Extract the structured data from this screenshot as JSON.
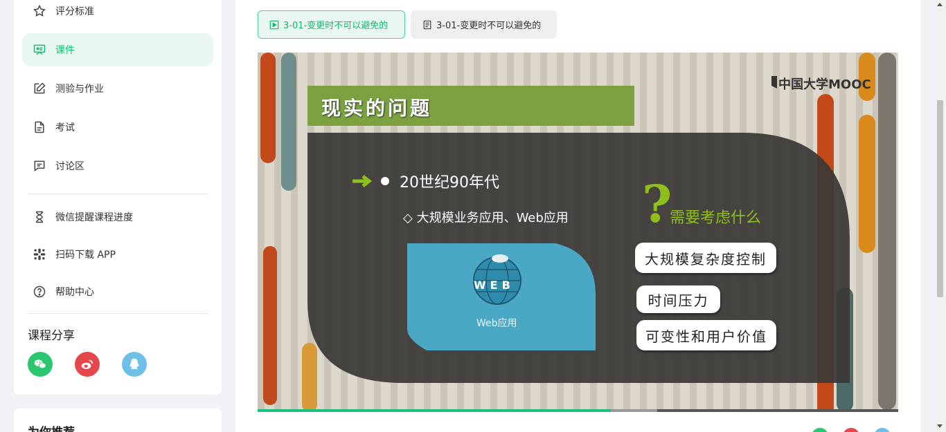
{
  "sidebar": {
    "items": [
      {
        "label": "评分标准",
        "icon": "star-icon"
      },
      {
        "label": "课件",
        "icon": "courseware-icon"
      },
      {
        "label": "测验与作业",
        "icon": "edit-icon"
      },
      {
        "label": "考试",
        "icon": "document-icon"
      },
      {
        "label": "讨论区",
        "icon": "chat-icon"
      }
    ],
    "extra_items": [
      {
        "label": "微信提醒课程进度",
        "icon": "hourglass-icon"
      },
      {
        "label": "扫码下载 APP",
        "icon": "qr-icon"
      },
      {
        "label": "帮助中心",
        "icon": "help-icon"
      }
    ],
    "share_title": "课程分享",
    "recommend_title": "为你推荐"
  },
  "tabs": [
    {
      "label": "3-01-变更时不可以避免的",
      "icon": "video-icon",
      "active": true
    },
    {
      "label": "3-01-变更时不可以避免的",
      "icon": "document-icon",
      "active": false
    }
  ],
  "slide": {
    "title": "现实的问题",
    "logo": "中国大学MOOC",
    "bullet1": "20世纪90年代",
    "bullet2": "◇ 大规模业务应用、Web应用",
    "question": "需要考虑什么",
    "web_mark": "WEB",
    "web_label": "Web应用",
    "pills": [
      "大规模复杂度控制",
      "时间压力",
      "可变性和用户价值"
    ]
  },
  "player": {
    "played": 0.551,
    "loaded": 0.624
  },
  "colors": {
    "accent": "#10c070",
    "wechat": "#2ac670",
    "weibo": "#e6474d",
    "qq": "#6fc0e8"
  }
}
